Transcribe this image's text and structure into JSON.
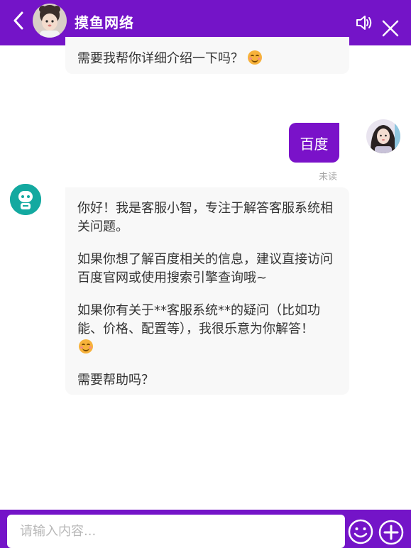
{
  "header": {
    "title": "摸鱼网络",
    "back_icon": "chevron-left-icon",
    "speaker_icon": "speaker-icon",
    "close_icon": "close-icon",
    "background_color": "#7414c8"
  },
  "messages": {
    "prev_bot_tail": "需要我帮你详细介绍一下吗？",
    "user_message": "百度",
    "read_status": "未读",
    "bot_reply": {
      "p1": "你好！我是客服小智，专注于解答客服系统相关问题。",
      "p2": "如果你想了解百度相关的信息，建议直接访问百度官网或使用搜索引擎查询哦~",
      "p3": "如果你有关于**客服系统**的疑问（比如功能、价格、配置等），我很乐意为你解答！",
      "p4": "需要帮助吗？"
    }
  },
  "footer": {
    "input_placeholder": "请输入内容...",
    "input_value": "",
    "emoji_icon": "smiley-icon",
    "plus_icon": "plus-circle-icon"
  },
  "colors": {
    "accent": "#7414c8",
    "user_bubble": "#7a12c9",
    "bot_bubble": "#f8f8f8",
    "bot_avatar": "#13a9a0"
  }
}
